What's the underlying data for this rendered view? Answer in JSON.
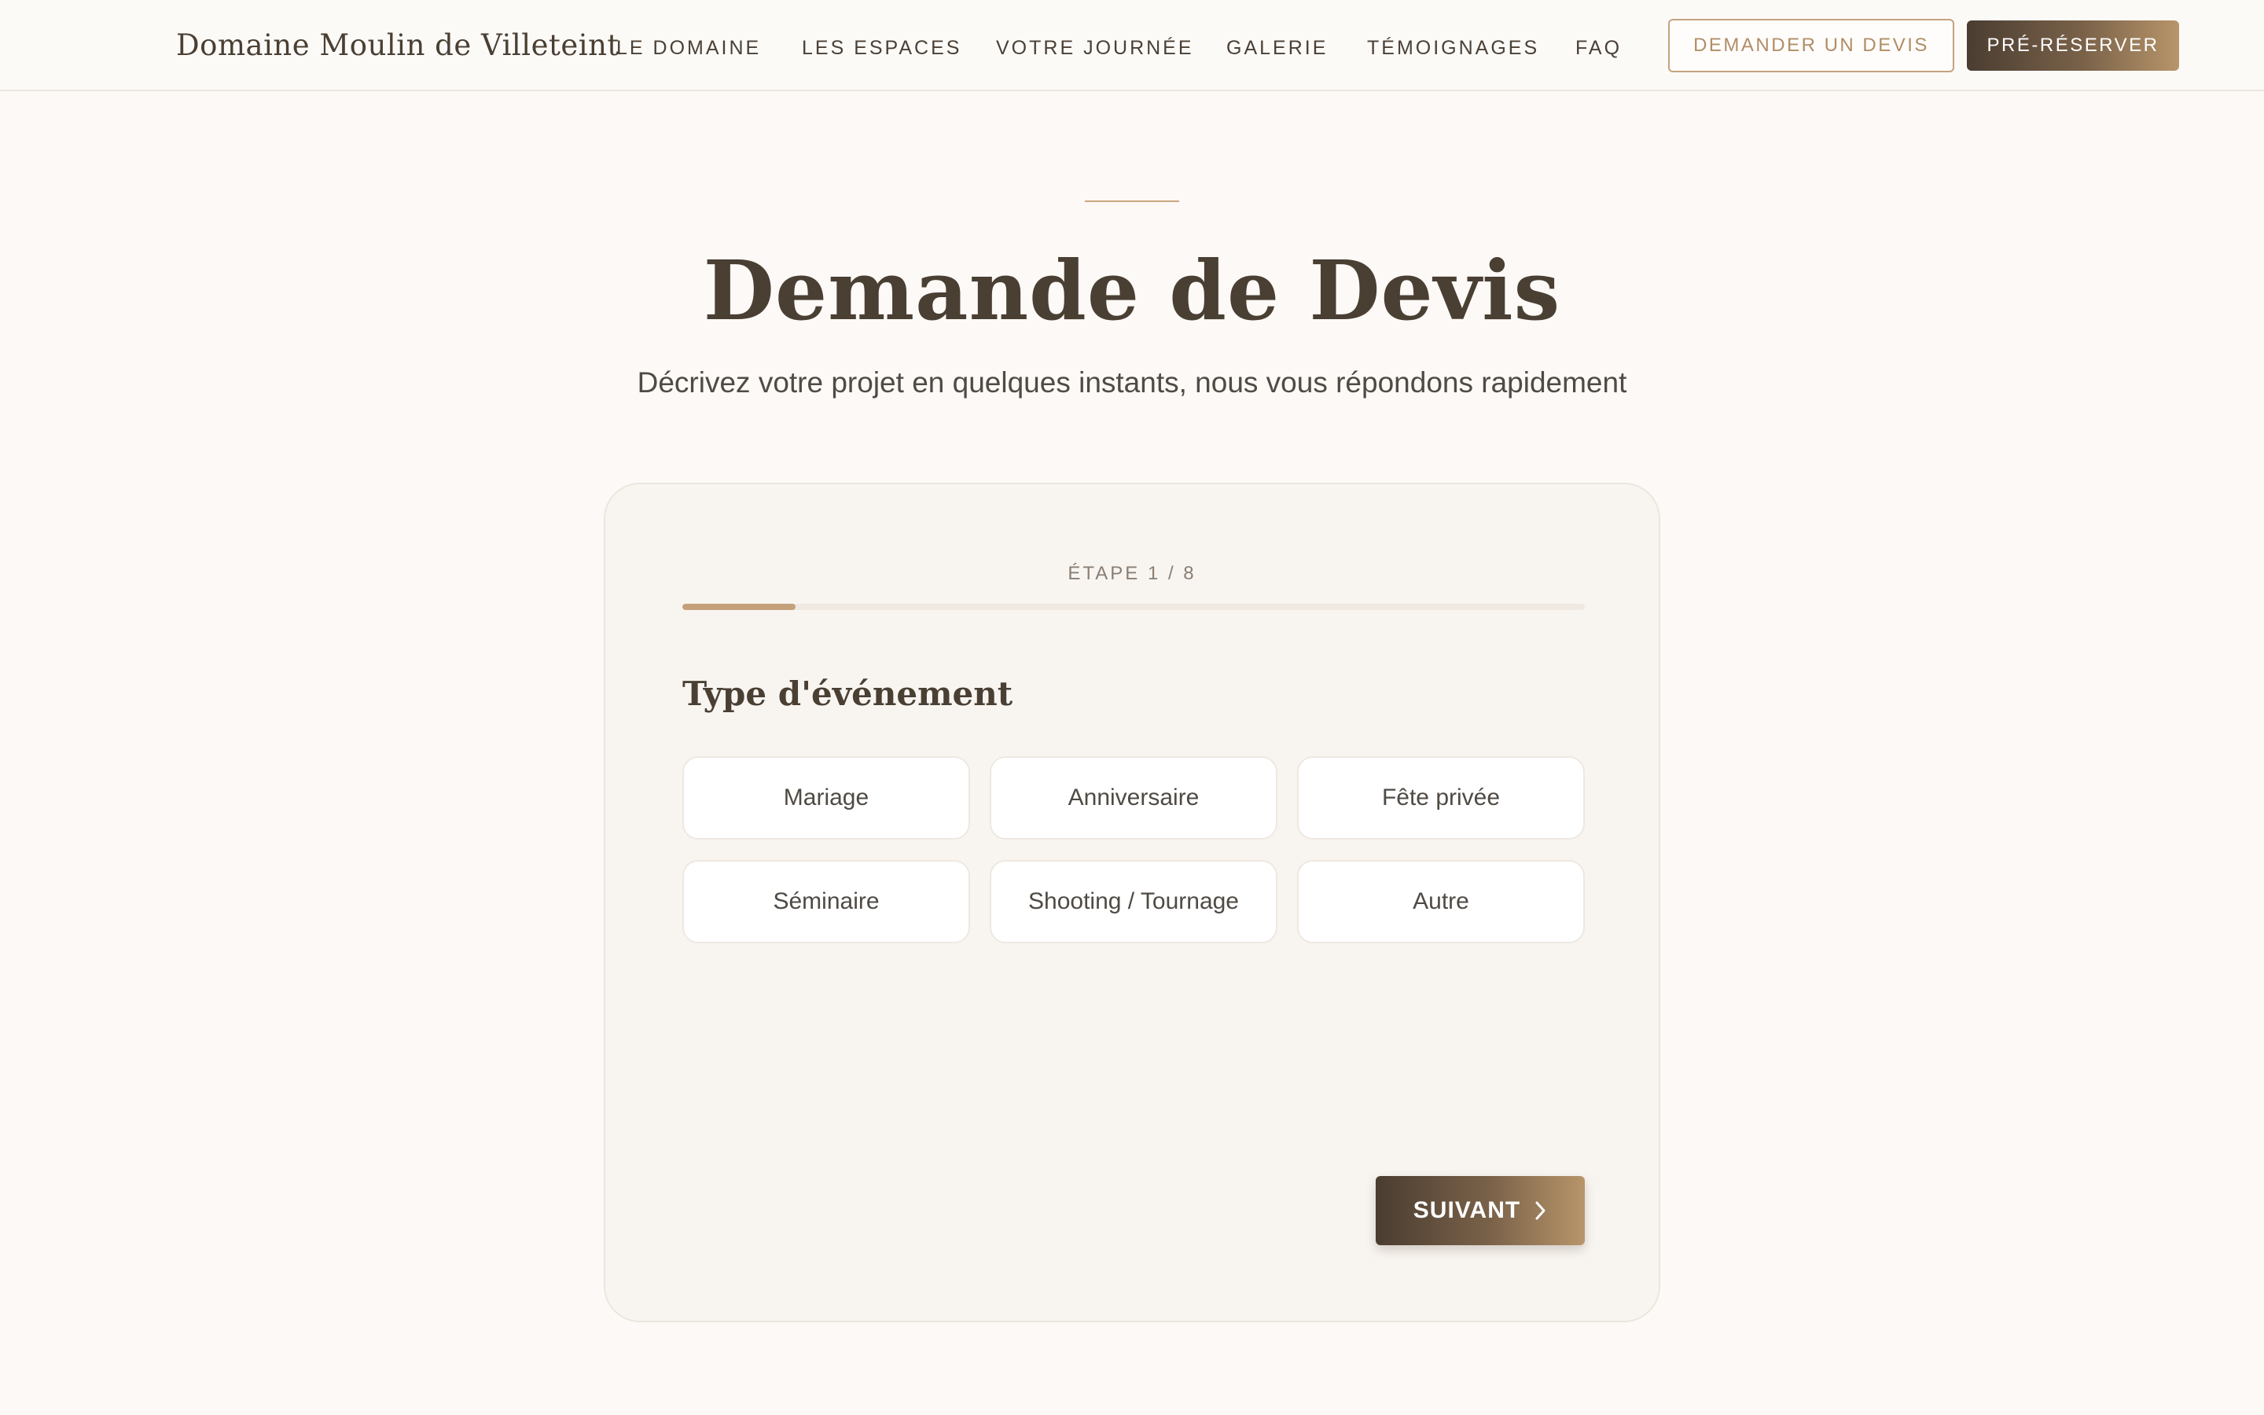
{
  "header": {
    "brand": "Domaine Moulin de Villeteint",
    "nav": [
      "LE DOMAINE",
      "LES ESPACES",
      "VOTRE JOURNÉE",
      "GALERIE",
      "TÉMOIGNAGES",
      "FAQ"
    ],
    "quote_button": "DEMANDER UN DEVIS",
    "prebook_button": "PRÉ-RÉSERVER"
  },
  "hero": {
    "title": "Demande de Devis",
    "subtitle": "Décrivez votre projet en quelques instants, nous vous répondons rapidement"
  },
  "form": {
    "step_label": "ÉTAPE 1 / 8",
    "progress": 0.125,
    "section_title": "Type d'événement",
    "options": [
      "Mariage",
      "Anniversaire",
      "Fête privée",
      "Séminaire",
      "Shooting / Tournage",
      "Autre"
    ],
    "next_button": "SUIVANT",
    "next_icon": "chevron-right-icon"
  },
  "colors": {
    "background": "#fcf9f6",
    "accent": "#c4a17b",
    "text_dark": "#4a3f33",
    "button_gradient_start": "#4a3d31",
    "button_gradient_end": "#b8956a"
  }
}
